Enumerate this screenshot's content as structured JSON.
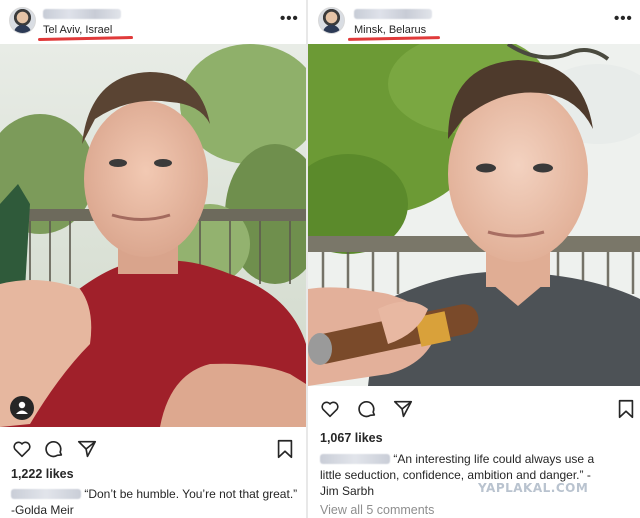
{
  "left_post": {
    "username": "jacobwohl",
    "location": "Tel Aviv, Israel",
    "likes": "1,222 likes",
    "caption_user": "jacobwohl",
    "caption_text": "“Don’t be humble. You’re not that great.”",
    "caption_text_2": "-Golda Meir",
    "icons": [
      "heart-icon",
      "comment-icon",
      "share-icon",
      "bookmark-icon",
      "user-tag-icon",
      "more-icon"
    ]
  },
  "right_post": {
    "username": "jacobwohl",
    "location": "Minsk, Belarus",
    "likes": "1,067 likes",
    "caption_user": "jacobwohl",
    "caption_text": "“An interesting life could always use a",
    "caption_text_2": "little seduction, confidence, ambition and danger.” -",
    "caption_text_3": "Jim Sarbh",
    "view_comments": "View all 5 comments",
    "icons": [
      "heart-icon",
      "comment-icon",
      "share-icon",
      "bookmark-icon",
      "more-icon"
    ]
  },
  "watermark": "YAPLAKAL.COM",
  "colors": {
    "underline": "#e03a3a",
    "text": "#262626",
    "muted": "#8e8e8e"
  }
}
